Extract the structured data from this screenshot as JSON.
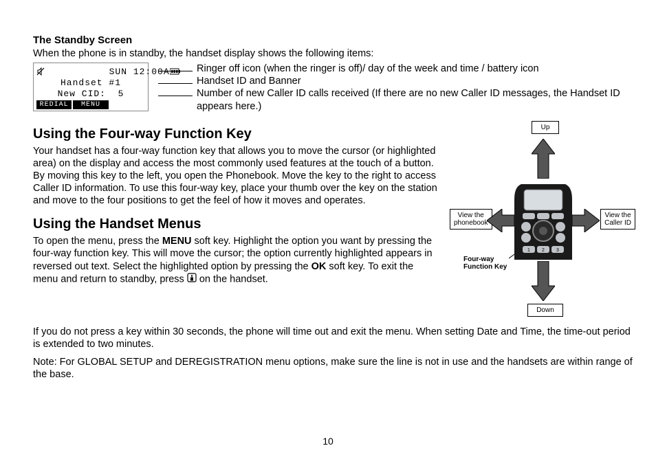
{
  "page_number": "10",
  "standby": {
    "heading": "The Standby Screen",
    "intro": "When the phone is in standby, the handset display shows the following items:",
    "lcd": {
      "time": "SUN 12:00A",
      "handset": "Handset #1",
      "cid": "New CID:  5",
      "soft_left": "REDIAL",
      "soft_mid": "MENU"
    },
    "callouts": {
      "line1": "Ringer off icon (when the ringer is off)/ day of the week and time / battery icon",
      "line2": "Handset ID and Banner",
      "line3": "Number of new Caller ID calls received (If there are no new Caller ID messages, the Handset ID appears here.)"
    }
  },
  "fourway": {
    "heading": "Using the Four-way Function Key",
    "body": "Your handset has a four-way function key that allows you to move the cursor (or highlighted area) on the display and access the most commonly used features at the touch of a button. By moving this key to the left, you open the Phonebook. Move the key to the right to access Caller ID information. To use this four-way key, place your thumb over the key on the station and move to the four positions to get the feel of how it moves and operates."
  },
  "menus": {
    "heading": "Using the Handset Menus",
    "p1a": "To open the menu, press the ",
    "menu_bold": "MENU",
    "p1b": " soft key. Highlight the option you want by pressing the four-way function key. This will move the cursor; the option currently highlighted appears in reversed out text. Select the highlighted option by pressing the ",
    "ok_bold": "OK",
    "p1c": " soft key. To exit the menu and return to standby, press ",
    "end_icon_alt": "[end]",
    "p1d": " on the handset.",
    "p2": "If you do not press a key within 30 seconds, the phone will time out and exit the menu. When setting Date and Time, the time-out period is extended to two minutes.",
    "p3": "Note: For GLOBAL SETUP and DEREGISTRATION menu options, make sure the line is not in use and the handsets are within range of the base."
  },
  "diagram": {
    "up": "Up",
    "down": "Down",
    "left_a": "View the",
    "left_b": "phonebook",
    "right_a": "View the",
    "right_b": "Caller ID",
    "fk_a": "Four-way",
    "fk_b": "Function Key"
  }
}
